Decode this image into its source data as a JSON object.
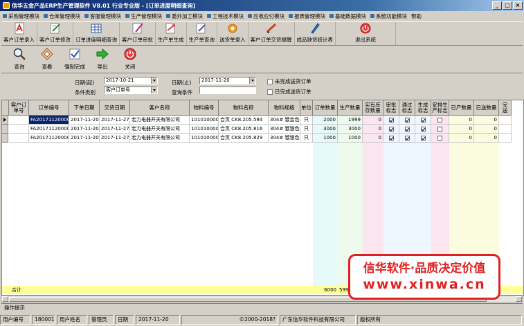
{
  "window": {
    "title": "信华五金产品ERP生产管理软件  V8.01 行业专业版 - [订单进度明细查询]"
  },
  "menu": [
    "采购管理模块",
    "仓库管理模块",
    "客服管理模块",
    "生产管理模块",
    "委外加工模块",
    "工程技术模块",
    "应收应付模块",
    "报表管理模块",
    "基础数据模块",
    "系统功能模块",
    "帮助"
  ],
  "toolbar1": [
    {
      "label": "客户订单录入",
      "icon": "pdf-doc-icon"
    },
    {
      "label": "客户订单修改",
      "icon": "edit-doc-icon"
    },
    {
      "label": "订单进度明细查询",
      "icon": "grid-view-icon"
    },
    {
      "label": "客户订单审批",
      "icon": "approve-icon"
    },
    {
      "label": "生产单生成",
      "icon": "arrow-doc-icon"
    },
    {
      "label": "生产单查询",
      "icon": "search-doc-icon"
    },
    {
      "label": "送货单录入",
      "icon": "delivery-icon"
    },
    {
      "label": "客户订单交货提醒",
      "icon": "bell-icon"
    },
    {
      "label": "成品缺货统计表",
      "icon": "chart-icon"
    },
    {
      "label": "退出系统",
      "icon": "power-icon"
    }
  ],
  "toolbar2": [
    {
      "label": "查询",
      "icon": "magnifier-icon"
    },
    {
      "label": "查看",
      "icon": "view-icon"
    },
    {
      "label": "强制完成",
      "icon": "force-complete-icon"
    },
    {
      "label": "导出",
      "icon": "export-arrow-icon"
    },
    {
      "label": "关闭",
      "icon": "close-circle-icon"
    }
  ],
  "filter": {
    "date_from_label": "日期(起)",
    "date_from": "2017-10-21",
    "date_to_label": "日期(止)",
    "date_to": "2017-11-20",
    "cond_type_label": "条件类别",
    "cond_type": "客户订单号",
    "cond_label": "查询条件",
    "cond_value": "",
    "chk_uncompleted": "未完成送货订单",
    "chk_completed": "已完成送货订单"
  },
  "grid": {
    "headers": [
      "客户订\n单号",
      "订单编号",
      "下单日期",
      "交货日期",
      "客户名称",
      "物料编号",
      "物料名称",
      "物料规格",
      "单位",
      "订单数量",
      "生产数量",
      "实有库\n存数量",
      "审批\n标志",
      "通过\n标志",
      "生成\n标志",
      "安排生\n产标志",
      "已产数量",
      "已送数量",
      "完\n送"
    ],
    "rows": [
      {
        "po": "",
        "order_no": "FA2017112000001",
        "order_date": "2017-11-20",
        "due_date": "2017-11-27",
        "customer": "宏力电器开关有限公司",
        "mat_no": "1010100001",
        "mat_name": "合页 CK8.205.584",
        "spec": "304# 镀金色",
        "unit": "只",
        "qty": "2000",
        "prod_qty": "1999",
        "stock": "0",
        "approve": true,
        "pass": true,
        "gen": true,
        "arrange": false,
        "produced": "0",
        "delivered": "0"
      },
      {
        "po": "",
        "order_no": "FA2017112000001",
        "order_date": "2017-11-20",
        "due_date": "2017-11-27",
        "customer": "宏力电器开关有限公司",
        "mat_no": "1010100002",
        "mat_name": "合页 CK8.205.816",
        "spec": "304# 镀银色",
        "unit": "只",
        "qty": "3000",
        "prod_qty": "3000",
        "stock": "0",
        "approve": true,
        "pass": true,
        "gen": true,
        "arrange": false,
        "produced": "0",
        "delivered": "0"
      },
      {
        "po": "",
        "order_no": "FA2017112000001",
        "order_date": "2017-11-20",
        "due_date": "2017-11-27",
        "customer": "宏力电器开关有限公司",
        "mat_no": "1010100003",
        "mat_name": "合页 CK8.205.829",
        "spec": "304# 镀银色",
        "unit": "只",
        "qty": "1000",
        "prod_qty": "1000",
        "stock": "0",
        "approve": true,
        "pass": true,
        "gen": true,
        "arrange": false,
        "produced": "0",
        "delivered": "0"
      }
    ],
    "total_label": "合计",
    "total_qty": "6000",
    "total_prod": "599",
    "total_last": "0"
  },
  "op_hint": "操作提示",
  "status": {
    "user_no_label": "用户编号",
    "user_no": "180001",
    "user_name_label": "用户姓名",
    "user_name": "管理员",
    "date_label": "日期",
    "date": "2017-11-20",
    "copyright": "©2000-2018?",
    "company": "广东信华软件科技有限公司",
    "rights": "版权所有"
  },
  "promo": {
    "line1": "信华软件·品质决定价值",
    "line2": "www.xinwa.cn"
  }
}
